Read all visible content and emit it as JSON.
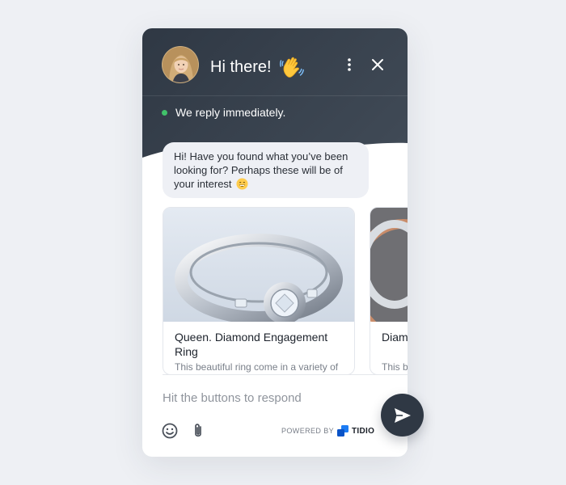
{
  "header": {
    "title": "Hi there!",
    "status": "We reply immediately."
  },
  "message": {
    "text": "Hi! Have you found what you’ve been looking for? Perhaps these will be of your interest"
  },
  "cards": [
    {
      "title": "Queen. Diamond Engagement Ring",
      "description": "This beautiful ring come in a variety of"
    },
    {
      "title": "Diam",
      "description": "This b widths"
    }
  ],
  "composer": {
    "placeholder": "Hit the buttons to respond"
  },
  "footer": {
    "powered_by": "POWERED BY",
    "brand": "TIDIO"
  },
  "colors": {
    "header_dark": "#2f3844",
    "status_online": "#41c26a",
    "bubble_bg": "#eef0f5",
    "brand_blue": "#1c7cf4"
  }
}
